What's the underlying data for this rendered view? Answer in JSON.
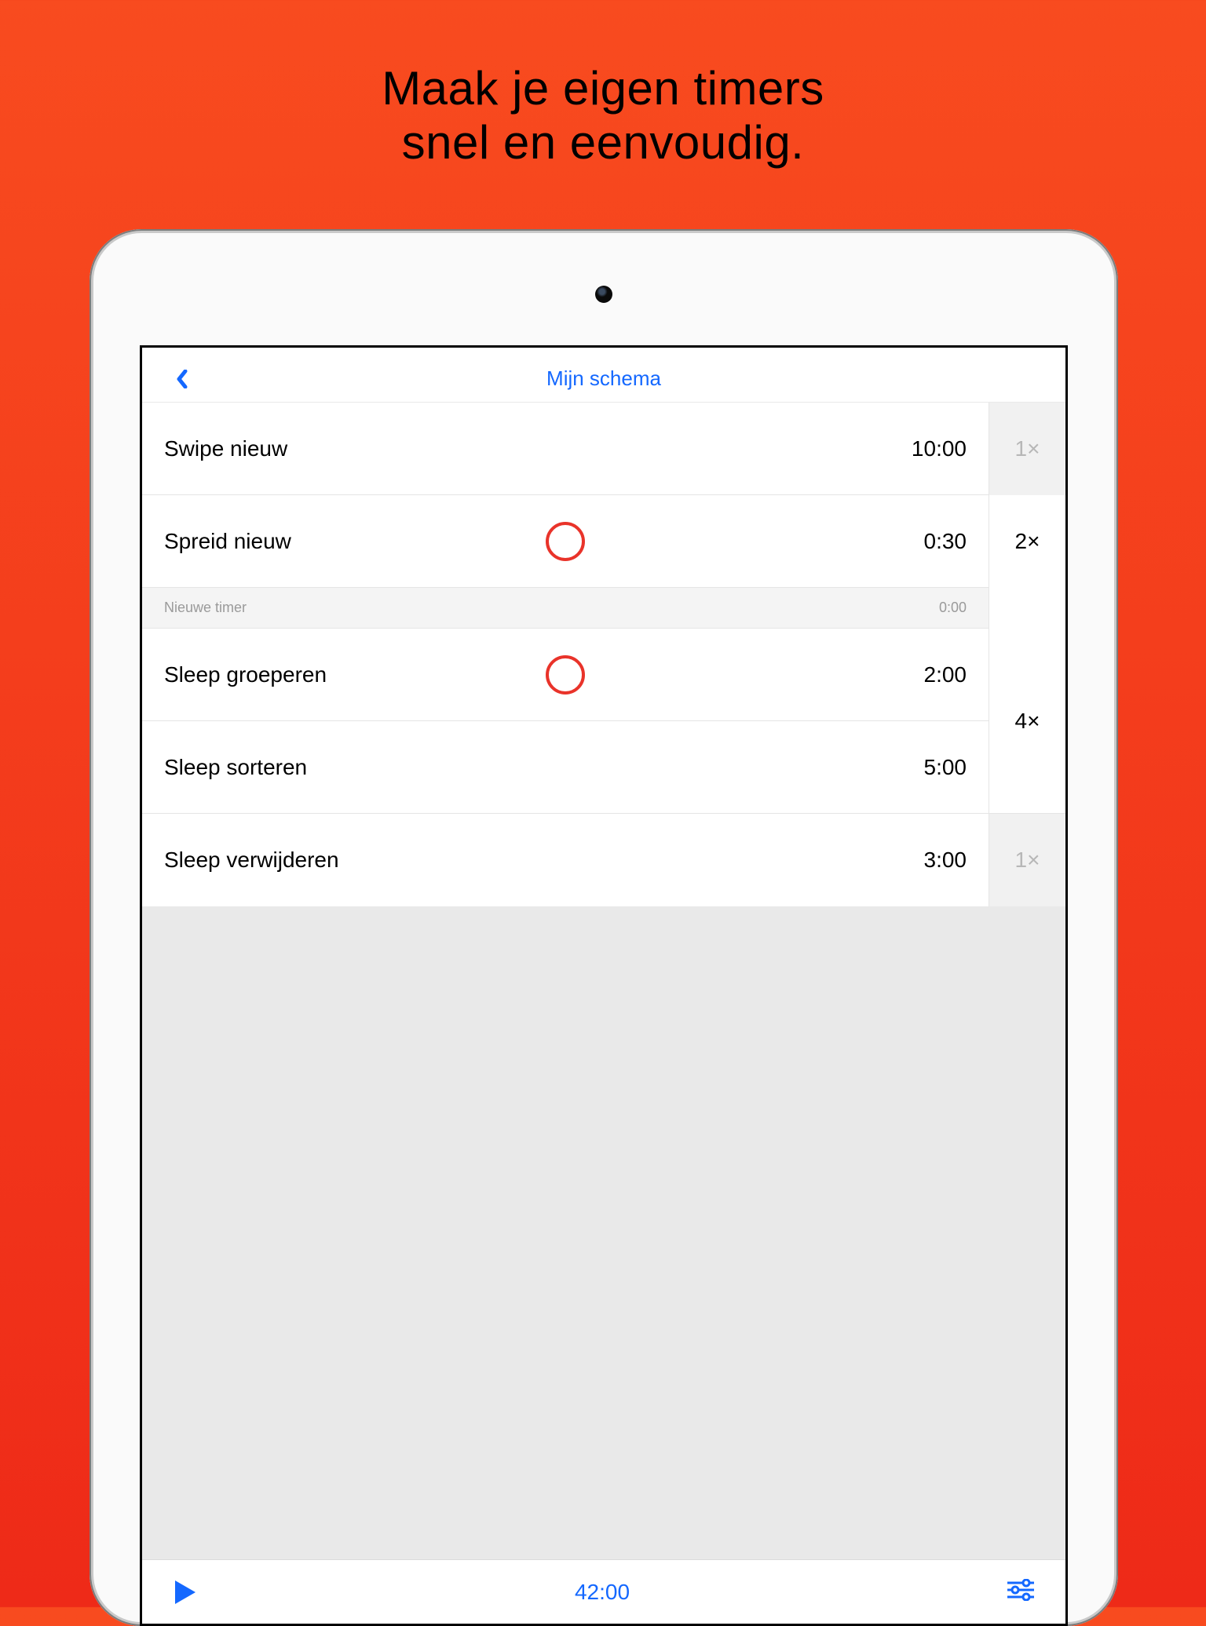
{
  "promo": {
    "line1": "Maak je eigen timers",
    "line2": "snel en eenvoudig."
  },
  "nav": {
    "title": "Mijn schema"
  },
  "rows": {
    "r1": {
      "name": "Swipe nieuw",
      "time": "10:00",
      "mult": "1×"
    },
    "r2": {
      "name": "Spreid nieuw",
      "time": "0:30",
      "mult": "2×"
    },
    "r3": {
      "name": "Nieuwe timer",
      "time": "0:00"
    },
    "r4": {
      "name": "Sleep groeperen",
      "time": "2:00"
    },
    "r5": {
      "name": "Sleep sorteren",
      "time": "5:00"
    },
    "group45_mult": "4×",
    "r6": {
      "name": "Sleep verwijderen",
      "time": "3:00",
      "mult": "1×"
    }
  },
  "toolbar": {
    "total": "42:00"
  },
  "colors": {
    "accent_blue": "#1468ff",
    "accent_red": "#e9332a",
    "bg_gradient_top": "#f84b1f",
    "bg_gradient_bottom": "#ee2a18"
  },
  "icons": {
    "back": "chevron-left-icon",
    "play": "play-icon",
    "settings": "sliders-icon"
  }
}
